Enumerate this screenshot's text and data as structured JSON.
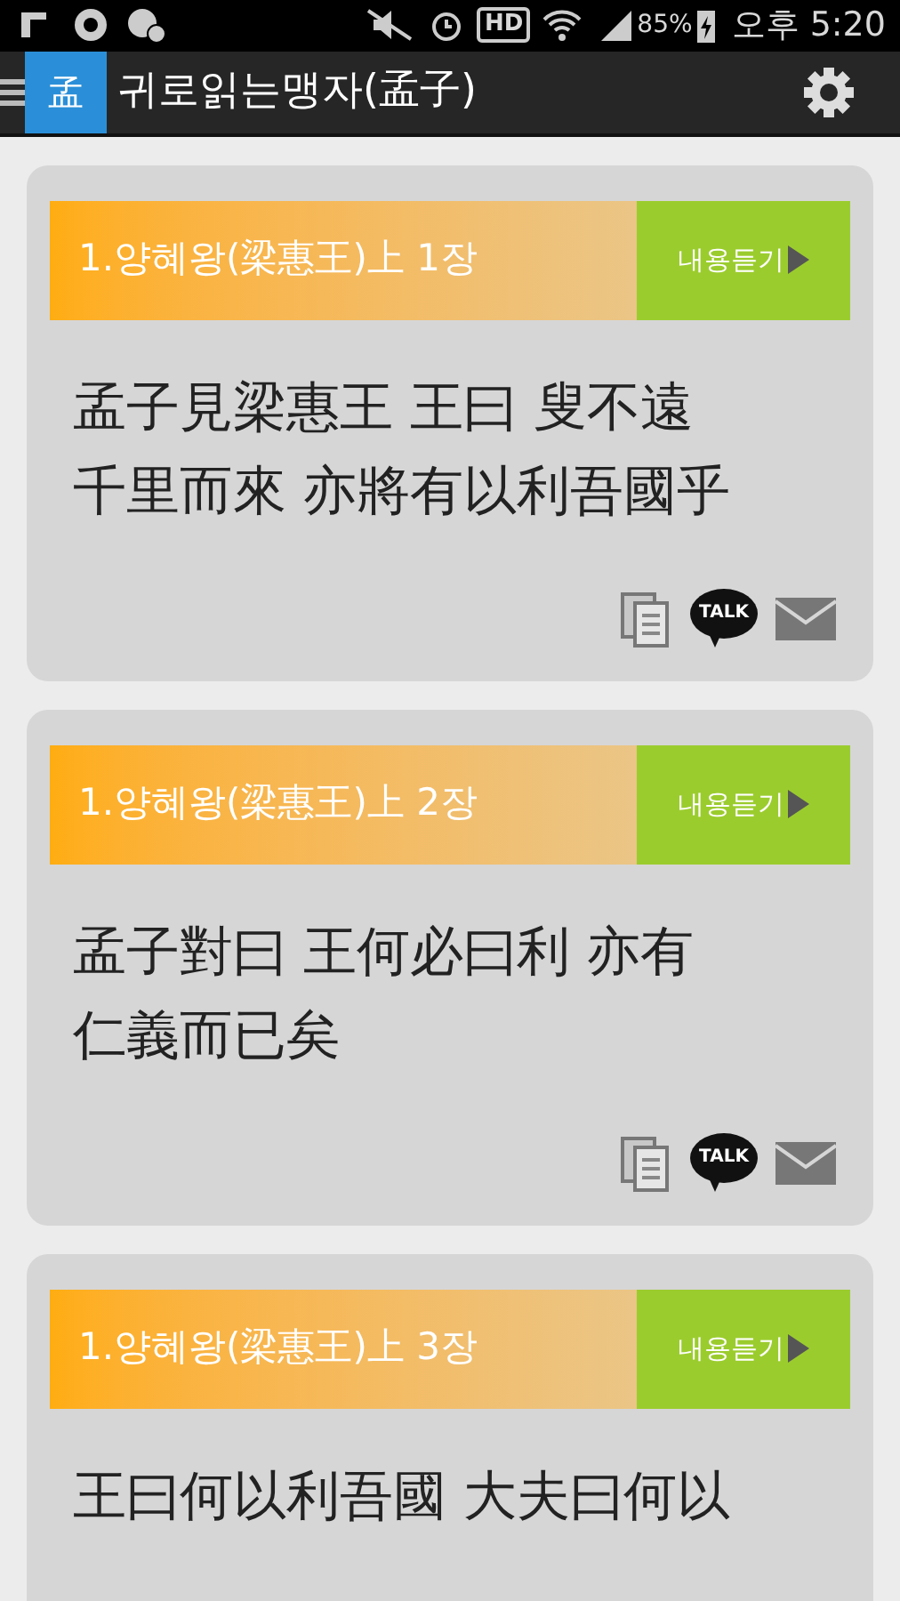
{
  "status_bar": {
    "hd": "HD",
    "battery": "85%",
    "time": "오후 5:20"
  },
  "app_bar": {
    "title": "귀로읽는맹자(孟子)",
    "logo_char": "孟"
  },
  "cards": [
    {
      "title": "1.양혜왕(梁惠王)上 1장",
      "listen": "내용듣기",
      "lines": [
        "孟子見梁惠王 王曰 叟不遠",
        "千里而來 亦將有以利吾國乎"
      ],
      "talk_label": "TALK"
    },
    {
      "title": "1.양혜왕(梁惠王)上 2장",
      "listen": "내용듣기",
      "lines": [
        "孟子對曰 王何必曰利 亦有",
        "仁義而已矣"
      ],
      "talk_label": "TALK"
    },
    {
      "title": "1.양혜왕(梁惠王)上 3장",
      "listen": "내용듣기",
      "lines": [
        "王曰何以利吾國 大夫曰何以"
      ]
    }
  ]
}
